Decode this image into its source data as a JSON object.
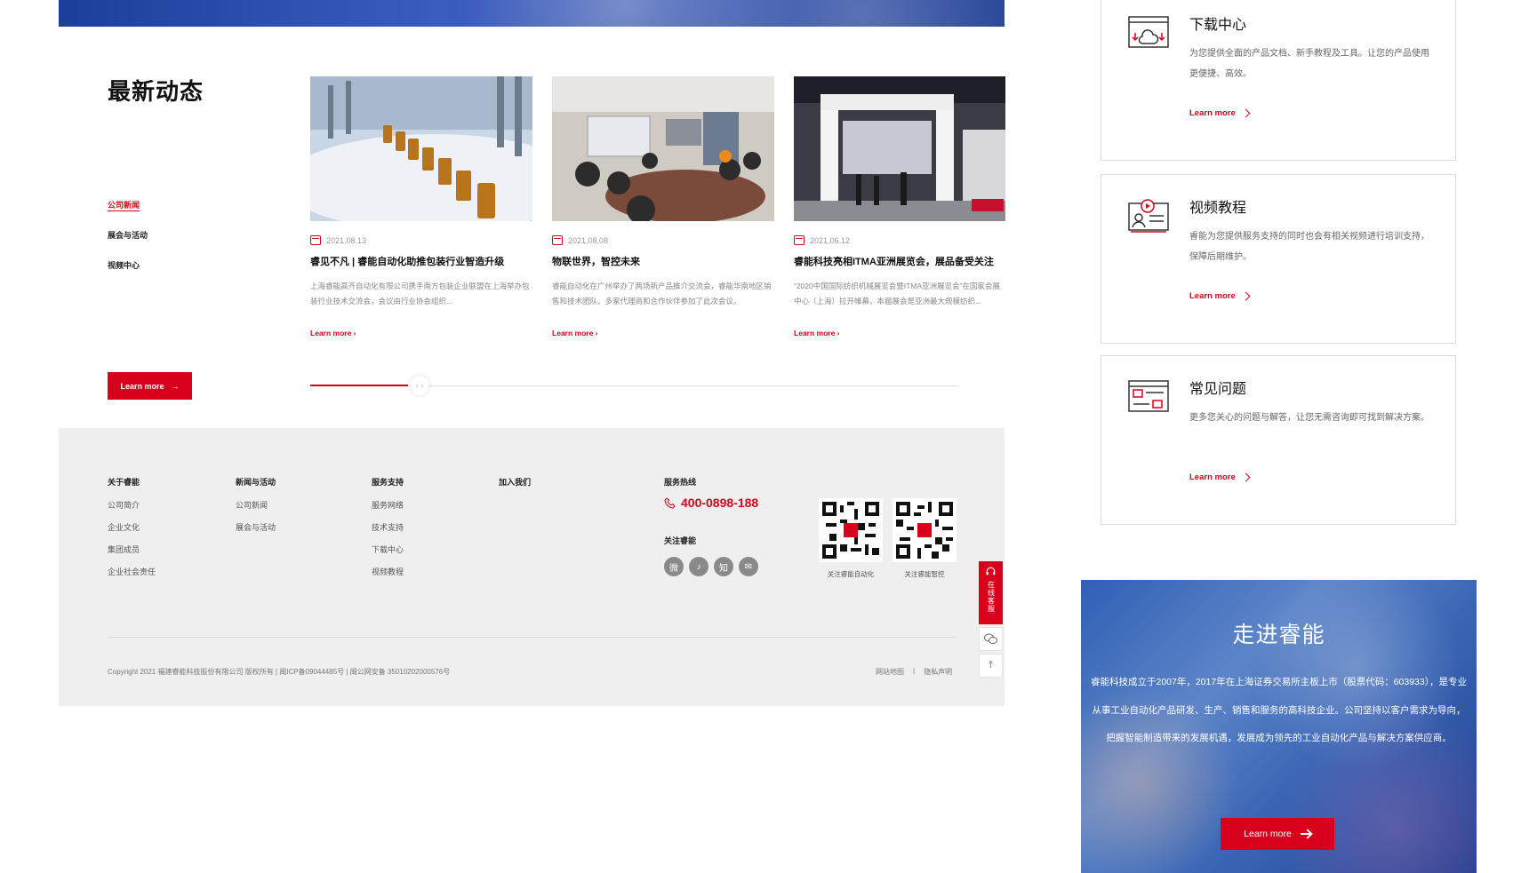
{
  "news": {
    "title": "最新动态",
    "tabs": [
      "公司新闻",
      "展会与活动",
      "视频中心"
    ],
    "cta": "Learn more",
    "cards": [
      {
        "date": "2021.08.13",
        "title": "睿见不凡 | 睿能自动化助推包装行业智造升级",
        "desc": "上海睿能高齐自动化有限公司携手南方包装企业联盟在上海举办包装行业技术交流会，会议由行业协会组织...",
        "link": "Learn more"
      },
      {
        "date": "2021.08.08",
        "title": "物联世界，智控未来",
        "desc": "睿能自动化在广州举办了两场新产品推介交流会，睿能华南地区销售和技术团队、多家代理商和合作伙伴参加了此次会议。",
        "link": "Learn more"
      },
      {
        "date": "2021.06.12",
        "title": "睿能科技亮相ITMA亚洲展览会，展品备受关注",
        "desc": "“2020中国国际纺织机械展览会暨ITMA亚洲展览会”在国家会展中心（上海）拉开帷幕，本届展会是亚洲最大规模纺织...",
        "link": "Learn more"
      }
    ]
  },
  "footer": {
    "columns": [
      {
        "heading": "关于睿能",
        "items": [
          "公司简介",
          "企业文化",
          "集团成员",
          "企业社会责任"
        ]
      },
      {
        "heading": "新闻与活动",
        "items": [
          "公司新闻",
          "展会与活动"
        ]
      },
      {
        "heading": "服务支持",
        "items": [
          "服务网络",
          "技术支持",
          "下载中心",
          "视频教程"
        ]
      },
      {
        "heading": "加入我们",
        "items": []
      }
    ],
    "hotline_label": "服务热线",
    "hotline": "400-0898-188",
    "follow_label": "关注睿能",
    "social_icons": [
      "weibo-icon",
      "douyin-icon",
      "zhihu-icon",
      "mail-icon"
    ],
    "social_glyphs": [
      "微",
      "♪",
      "知",
      "✉"
    ],
    "qr1_caption": "关注睿能自动化",
    "qr2_caption": "关注睿能智控",
    "copyright": "Copyright 2021 福建睿能科技股份有限公司 版权所有 | 闽ICP备09044485号 | 闽公网安备 35010202000576号",
    "links": [
      "网站地图",
      "|",
      "隐私声明"
    ]
  },
  "float": {
    "service_label": "在线客服"
  },
  "services": [
    {
      "title": "下载中心",
      "desc": "为您提供全面的产品文档、新手教程及工具。让您的产品使用更便捷、高效。",
      "link": "Learn more"
    },
    {
      "title": "视频教程",
      "desc": "睿能为您提供服务支持的同时也会有相关视频进行培训支持，保障后期维护。",
      "link": "Learn more"
    },
    {
      "title": "常见问题",
      "desc": "更多您关心的问题与解答，让您无需咨询即可找到解决方案。",
      "link": "Learn more"
    }
  ],
  "about": {
    "title": "走进睿能",
    "desc": "睿能科技成立于2007年，2017年在上海证券交易所主板上市（股票代码：603933），是专业从事工业自动化产品研发、生产、销售和服务的高科技企业。公司坚持以客户需求为导向，把握智能制造带来的发展机遇，发展成为领先的工业自动化产品与解决方案供应商。",
    "button": "Learn more"
  },
  "colors": {
    "accent": "#d8001b",
    "footer_bg": "#efefef"
  }
}
